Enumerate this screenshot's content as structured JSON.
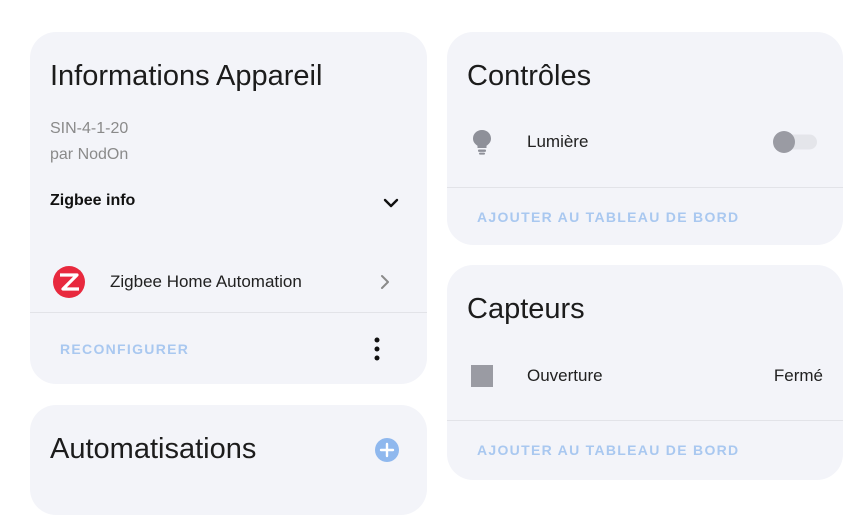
{
  "device_card": {
    "title": "Informations Appareil",
    "model": "SIN-4-1-20",
    "manufacturer": "par NodOn",
    "zigbee_info_label": "Zigbee info",
    "integration_label": "Zigbee Home Automation",
    "reconfigure_label": "RECONFIGURER",
    "icons": {
      "expand": "chevron-down-icon",
      "integration": "zigbee-logo-icon",
      "open": "chevron-right-icon",
      "menu": "more-vertical-icon"
    }
  },
  "automations_card": {
    "title": "Automatisations",
    "icons": {
      "add": "plus-circle-icon"
    }
  },
  "controls_card": {
    "title": "Contrôles",
    "entity_label": "Lumière",
    "toggle_on": false,
    "add_to_dashboard_label": "AJOUTER AU TABLEAU DE BORD",
    "icons": {
      "entity": "lightbulb-icon"
    }
  },
  "sensors_card": {
    "title": "Capteurs",
    "entity_label": "Ouverture",
    "entity_state": "Fermé",
    "add_to_dashboard_label": "AJOUTER AU TABLEAU DE BORD",
    "icons": {
      "entity": "door-closed-icon"
    }
  },
  "colors": {
    "card_background": "#f3f4f9",
    "link_accent": "#a9c8f0",
    "zigbee_red": "#e8293e",
    "add_button_blue": "#8fb8ee",
    "icon_grey": "#8e9099"
  }
}
